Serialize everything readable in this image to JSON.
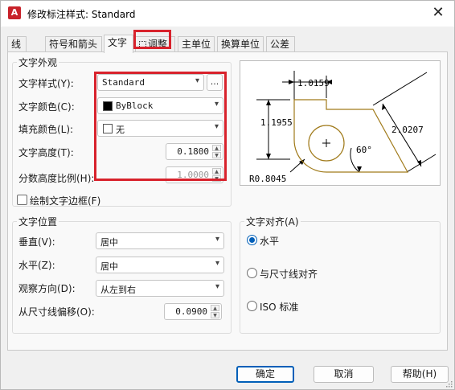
{
  "window": {
    "title": "修改标注样式: Standard",
    "close_glyph": "✕",
    "app_icon": "A"
  },
  "tabs": [
    "线",
    "符号和箭头",
    "文字",
    "调整",
    "主单位",
    "换算单位",
    "公差"
  ],
  "active_tab": "文字",
  "text_appearance": {
    "group_title": "文字外观",
    "style_label": "文字样式(Y):",
    "style_value": "Standard",
    "style_button": "...",
    "color_label": "文字颜色(C):",
    "color_value": "ByBlock",
    "fill_label": "填充颜色(L):",
    "fill_value": "无",
    "height_label": "文字高度(T):",
    "height_value": "0.1800",
    "fraction_label": "分数高度比例(H):",
    "fraction_value": "1.0000",
    "frame_label": "绘制文字边框(F)"
  },
  "text_placement": {
    "group_title": "文字位置",
    "vertical_label": "垂直(V):",
    "vertical_value": "居中",
    "horizontal_label": "水平(Z):",
    "horizontal_value": "居中",
    "view_label": "观察方向(D):",
    "view_value": "从左到右",
    "offset_label": "从尺寸线偏移(O):",
    "offset_value": "0.0900"
  },
  "text_alignment": {
    "group_title": "文字对齐(A)",
    "options": [
      "水平",
      "与尺寸线对齐",
      "ISO 标准"
    ],
    "selected": "水平"
  },
  "preview": {
    "dim_top": "1.0159",
    "dim_left": "1.1955",
    "dim_right": "2.0207",
    "angle": "60°",
    "radius": "R0.8045"
  },
  "buttons": {
    "ok": "确定",
    "cancel": "取消",
    "help": "帮助(H)"
  },
  "colors": {
    "accent": "#005fb8",
    "highlight_box": "#d8222c",
    "preview_line": "#a07a1a"
  }
}
